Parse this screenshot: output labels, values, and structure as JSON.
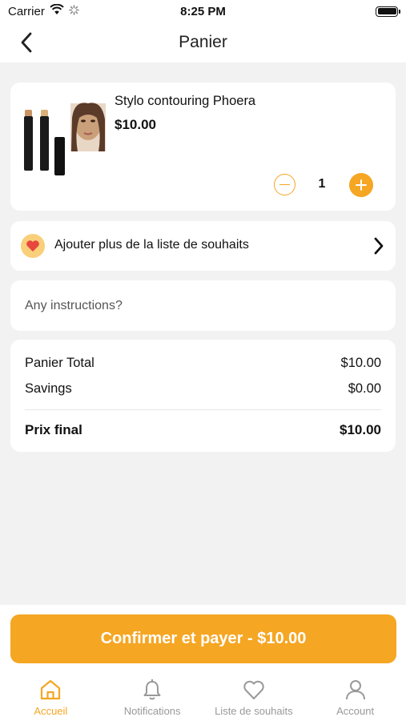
{
  "status_bar": {
    "carrier": "Carrier",
    "time": "8:25 PM"
  },
  "nav": {
    "title": "Panier"
  },
  "product": {
    "name": "Stylo contouring Phoera",
    "price": "$10.00",
    "quantity": "1"
  },
  "wishlist_row": {
    "label": "Ajouter plus de la liste de souhaits"
  },
  "instructions": {
    "placeholder": "Any instructions?",
    "value": ""
  },
  "summary": {
    "cart_total_label": "Panier Total",
    "cart_total_value": "$10.00",
    "savings_label": "Savings",
    "savings_value": "$0.00",
    "final_label": "Prix final",
    "final_value": "$10.00"
  },
  "pay_button": {
    "label": "Confirmer et payer - $10.00"
  },
  "tabs": [
    {
      "label": "Accueil",
      "icon": "home-icon",
      "active": true
    },
    {
      "label": "Notifications",
      "icon": "bell-icon",
      "active": false
    },
    {
      "label": "Liste de souhaits",
      "icon": "heart-icon",
      "active": false
    },
    {
      "label": "Account",
      "icon": "user-icon",
      "active": false
    }
  ],
  "colors": {
    "accent": "#f5a623",
    "background": "#f2f2f2",
    "card": "#ffffff",
    "inactive_tab": "#999999"
  }
}
